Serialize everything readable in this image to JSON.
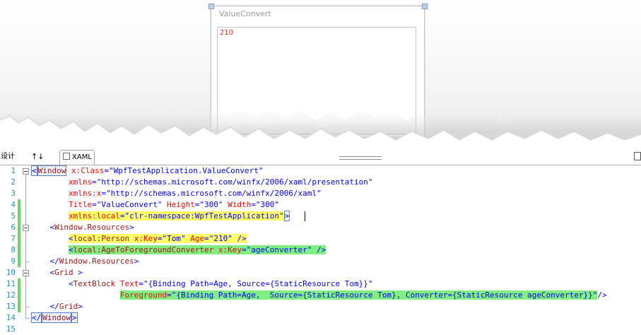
{
  "preview": {
    "window_title": "ValueConvert",
    "text_block_value": "210"
  },
  "tabs": {
    "design": "设计",
    "swap": "↑↓",
    "xaml": "XAML"
  },
  "editor": {
    "lines": [
      {
        "num": "1",
        "tokens": [
          {
            "t": "<",
            "c": "pu",
            "hl": "sel"
          },
          {
            "t": "Window",
            "c": "el",
            "hl": "sel"
          },
          {
            "t": " x:Class",
            "c": "at"
          },
          {
            "t": "=",
            "c": "pu"
          },
          {
            "t": "\"WpfTestApplication.ValueConvert\"",
            "c": "va"
          }
        ]
      },
      {
        "num": "2",
        "tokens": [
          {
            "t": "        xmlns",
            "c": "at"
          },
          {
            "t": "=",
            "c": "pu"
          },
          {
            "t": "\"http://schemas.microsoft.com/winfx/2006/xaml/presentation\"",
            "c": "va"
          }
        ]
      },
      {
        "num": "3",
        "tokens": [
          {
            "t": "        xmlns:x",
            "c": "at"
          },
          {
            "t": "=",
            "c": "pu"
          },
          {
            "t": "\"http://schemas.microsoft.com/winfx/2006/xaml\"",
            "c": "va"
          }
        ]
      },
      {
        "num": "4",
        "tokens": [
          {
            "t": "        Title",
            "c": "at"
          },
          {
            "t": "=",
            "c": "pu"
          },
          {
            "t": "\"ValueConvert\"",
            "c": "va"
          },
          {
            "t": " Height",
            "c": "at"
          },
          {
            "t": "=",
            "c": "pu"
          },
          {
            "t": "\"300\"",
            "c": "va"
          },
          {
            "t": " Width",
            "c": "at"
          },
          {
            "t": "=",
            "c": "pu"
          },
          {
            "t": "\"300\"",
            "c": "va"
          }
        ]
      },
      {
        "num": "5",
        "tokens": [
          {
            "t": "        ",
            "c": ""
          },
          {
            "t": "xmlns:local",
            "c": "at",
            "hl": "y"
          },
          {
            "t": "=",
            "c": "pu",
            "hl": "y"
          },
          {
            "t": "\"clr-namespace:WpfTestApplication\"",
            "c": "va",
            "hl": "y"
          },
          {
            "t": ">",
            "c": "pu",
            "hl": "sel"
          }
        ]
      },
      {
        "num": "6",
        "tokens": [
          {
            "t": "    <",
            "c": "pu"
          },
          {
            "t": "Window.Resources",
            "c": "el"
          },
          {
            "t": ">",
            "c": "pu"
          }
        ]
      },
      {
        "num": "7",
        "tokens": [
          {
            "t": "        ",
            "c": ""
          },
          {
            "t": "<",
            "c": "pu",
            "hl": "y"
          },
          {
            "t": "local:Person",
            "c": "el",
            "hl": "y"
          },
          {
            "t": " x:Key",
            "c": "at",
            "hl": "y"
          },
          {
            "t": "=",
            "c": "pu",
            "hl": "y"
          },
          {
            "t": "\"Tom\"",
            "c": "va",
            "hl": "y"
          },
          {
            "t": " Age",
            "c": "at",
            "hl": "y"
          },
          {
            "t": "=",
            "c": "pu",
            "hl": "y"
          },
          {
            "t": "\"210\"",
            "c": "va",
            "hl": "y"
          },
          {
            "t": " />",
            "c": "pu",
            "hl": "y"
          }
        ]
      },
      {
        "num": "8",
        "tokens": [
          {
            "t": "        ",
            "c": ""
          },
          {
            "t": "<",
            "c": "pu",
            "hl": "g"
          },
          {
            "t": "local:AgeToForegroundConverter",
            "c": "el",
            "hl": "g"
          },
          {
            "t": " x:Key",
            "c": "at",
            "hl": "g"
          },
          {
            "t": "=",
            "c": "pu",
            "hl": "g"
          },
          {
            "t": "\"ageConverter\"",
            "c": "va",
            "hl": "g"
          },
          {
            "t": " />",
            "c": "pu",
            "hl": "g"
          }
        ]
      },
      {
        "num": "9",
        "tokens": [
          {
            "t": "    </",
            "c": "pu"
          },
          {
            "t": "Window.Resources",
            "c": "el"
          },
          {
            "t": ">",
            "c": "pu"
          }
        ]
      },
      {
        "num": "10",
        "tokens": [
          {
            "t": "    <",
            "c": "pu"
          },
          {
            "t": "Grid",
            "c": "el"
          },
          {
            "t": " >",
            "c": "pu"
          }
        ]
      },
      {
        "num": "11",
        "tokens": [
          {
            "t": "        <",
            "c": "pu"
          },
          {
            "t": "TextBlock",
            "c": "el"
          },
          {
            "t": " Text",
            "c": "at"
          },
          {
            "t": "=",
            "c": "pu"
          },
          {
            "t": "\"{Binding Path=Age, Source={StaticResource Tom}}\"",
            "c": "va"
          }
        ]
      },
      {
        "num": "12",
        "tokens": [
          {
            "t": "                   ",
            "c": ""
          },
          {
            "t": "Foreground",
            "c": "at",
            "hl": "g"
          },
          {
            "t": "=",
            "c": "pu",
            "hl": "g"
          },
          {
            "t": "\"{Binding Path=Age,  Source={StaticResource Tom}, Converter={StaticResource ageConverter}}\"",
            "c": "va",
            "hl": "g"
          },
          {
            "t": "/>",
            "c": "pu"
          }
        ]
      },
      {
        "num": "13",
        "tokens": [
          {
            "t": "    </",
            "c": "pu"
          },
          {
            "t": "Grid",
            "c": "el"
          },
          {
            "t": ">",
            "c": "pu"
          }
        ]
      },
      {
        "num": "14",
        "tokens": [
          {
            "t": "</",
            "c": "pu",
            "hl": "sel"
          },
          {
            "t": "Window",
            "c": "el",
            "hl": "sel"
          },
          {
            "t": ">",
            "c": "pu",
            "hl": "sel"
          }
        ]
      },
      {
        "num": "15",
        "tokens": []
      }
    ]
  }
}
